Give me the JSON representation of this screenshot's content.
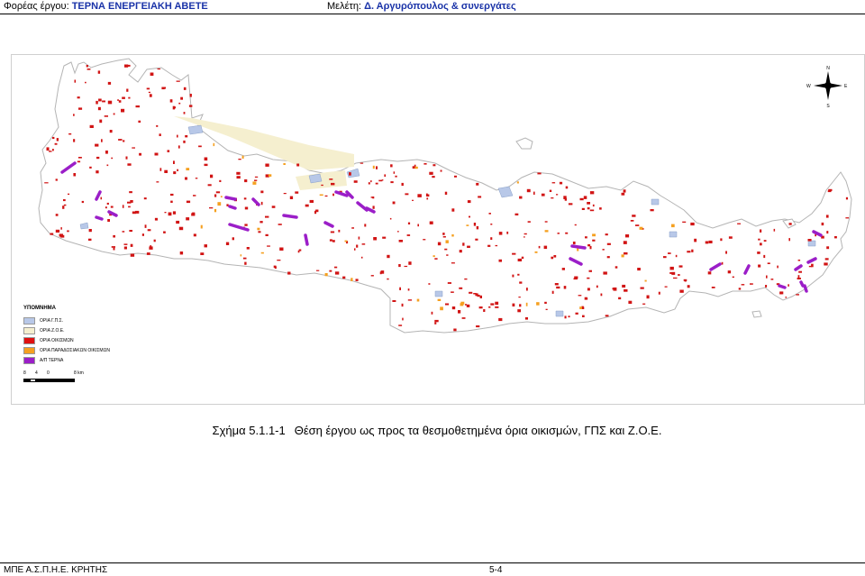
{
  "header": {
    "left_label": "Φορέας έργου:",
    "left_value": "ΤΕΡΝΑ ΕΝΕΡΓΕΙΑΚΗ ΑΒΕΤΕ",
    "right_label": "Μελέτη:",
    "right_value": "Δ. Αργυρόπουλος & συνεργάτες"
  },
  "map": {
    "compass": {
      "n": "N",
      "s": "S",
      "e": "E",
      "w": "W"
    },
    "legend": {
      "title": "ΥΠΟΜΝΗΜΑ",
      "items": [
        {
          "label": "ΟΡΙΑ Γ.Π.Σ.",
          "color": "#b8c8e8"
        },
        {
          "label": "ΟΡΙΑ Ζ.Ο.Ε.",
          "color": "#f5efcf"
        },
        {
          "label": "ΟΡΙΑ ΟΙΚΙΣΜΩΝ",
          "color": "#e01010"
        },
        {
          "label": "ΟΡΙΑ ΠΑΡΑΔΟΣΙΑΚΩΝ ΟΙΚΙΣΜΩΝ",
          "color": "#f5a020"
        },
        {
          "label": "Α/Π ΤΕΡΝΑ",
          "color": "#9b1ec8"
        }
      ]
    },
    "scale": {
      "ticks": [
        "8",
        "4",
        "0",
        "8 km"
      ]
    },
    "colors": {
      "land": "#ffffff",
      "coast": "#b8b8b8",
      "settlement": "#d11414",
      "traditional": "#f5a020",
      "wind": "#9b1ec8",
      "gps": "#b8c8e8",
      "zoe": "#f5efcf"
    }
  },
  "caption": {
    "label": "Σχήμα 5.1.1-1",
    "text": "Θέση έργου ως προς τα θεσμοθετημένα όρια οικισμών, ΓΠΣ και Ζ.Ο.Ε."
  },
  "footer": {
    "left": "ΜΠΕ Α.Σ.Π.Η.Ε. ΚΡΗΤΗΣ",
    "right": "5-4"
  }
}
